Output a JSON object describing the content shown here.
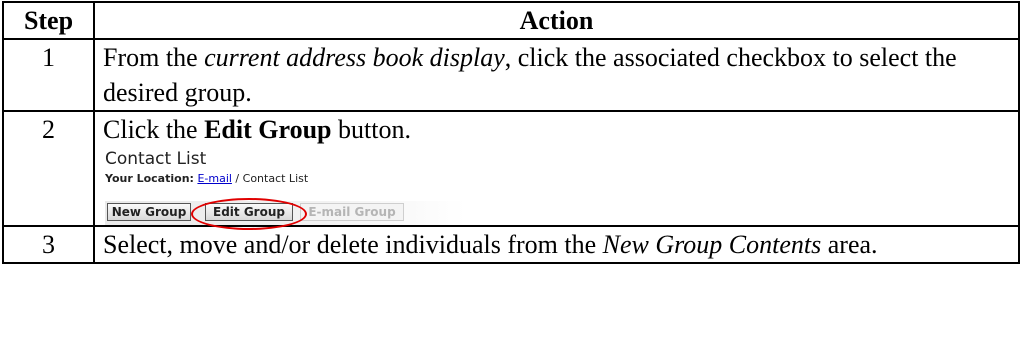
{
  "table": {
    "headers": {
      "step": "Step",
      "action": "Action"
    }
  },
  "steps": [
    {
      "number": "1",
      "text_before": "From the ",
      "text_emph": "current address book display",
      "text_after": ", click the associated checkbox to select the desired group."
    },
    {
      "number": "2",
      "text_before": "Click the ",
      "text_bold": "Edit Group",
      "text_after": " button."
    },
    {
      "number": "3",
      "text_before": "Select, move and/or delete individuals from the ",
      "text_emph": "New Group Contents",
      "text_after": " area."
    }
  ],
  "screenshot": {
    "title": "Contact List",
    "location_label": "Your Location:",
    "location_link": "E-mail",
    "location_separator": " / ",
    "location_current": "Contact List",
    "buttons": {
      "new_group": "New Group",
      "edit_group": "Edit Group",
      "email_group": "E-mail Group"
    },
    "highlight_color": "#e00000"
  }
}
